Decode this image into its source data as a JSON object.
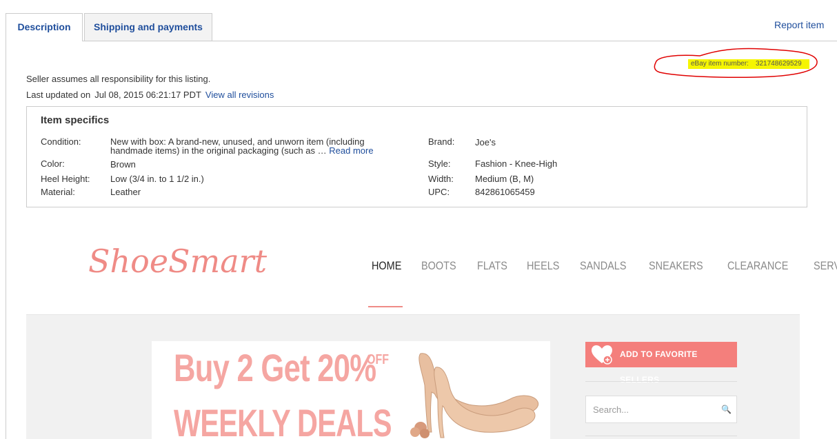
{
  "tabs": [
    {
      "label": "Description"
    },
    {
      "label": "Shipping and payments"
    }
  ],
  "report_label": "Report item",
  "item_number": {
    "label": "eBay item number:",
    "value": "321748629529"
  },
  "seller_note": "Seller assumes all responsibility for this listing.",
  "last_updated": {
    "label": "Last updated on",
    "date": "Jul 08, 2015 06:21:17 PDT",
    "link": "View all revisions"
  },
  "specifics": {
    "title": "Item specifics",
    "condition": {
      "label": "Condition:",
      "line1": "New with box: A brand-new, unused, and unworn item (including",
      "line2": "handmade items) in the original packaging (such as …",
      "link": "Read more"
    },
    "color": {
      "label": "Color:",
      "value": "Brown"
    },
    "heel_height": {
      "label": "Heel Height:",
      "value": "Low (3/4 in. to 1 1/2 in.)"
    },
    "material": {
      "label": "Material:",
      "value": "Leather"
    },
    "brand": {
      "label": "Brand:",
      "value": "Joe's"
    },
    "style": {
      "label": "Style:",
      "value": "Fashion - Knee-High"
    },
    "width": {
      "label": "Width:",
      "value": "Medium (B, M)"
    },
    "upc": {
      "label": "UPC:",
      "value": "842861065459"
    }
  },
  "store": {
    "logo": "ShoeSmart",
    "nav": [
      "HOME",
      "BOOTS",
      "FLATS",
      "HEELS",
      "SANDALS",
      "SNEAKERS",
      "CLEARANCE",
      "SERVICE"
    ],
    "banner_line1": "Buy 2 Get 20%",
    "banner_off": "OFF",
    "banner_line2": "WEEKLY DEALS",
    "fav_button": "ADD TO FAVORITE SELLERS",
    "search_placeholder": "Search..."
  },
  "colors": {
    "link": "#1f4e9c",
    "brand_pink": "#ef8b86",
    "button": "#f47f7c",
    "highlight": "#f5f500",
    "annotation": "#e00000"
  }
}
